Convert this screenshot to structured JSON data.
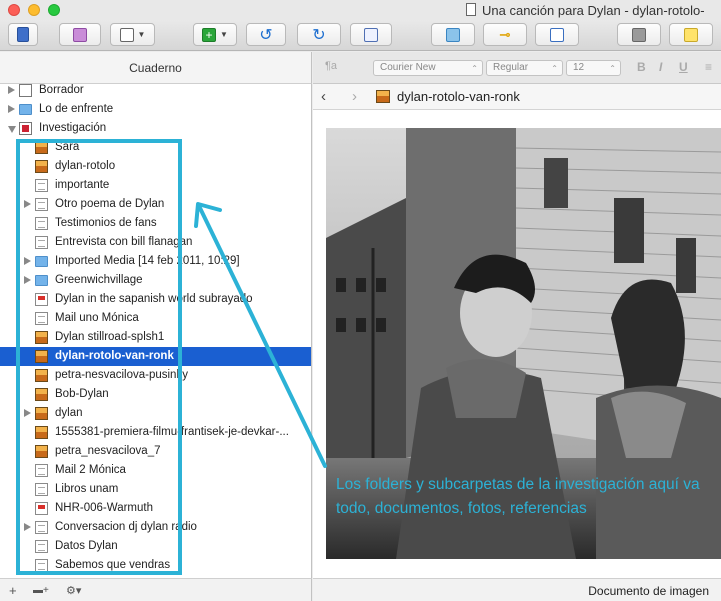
{
  "window": {
    "title": "Una canción para Dylan - dylan-rotolo-",
    "accent": "#1a5fd1",
    "annotation_color": "#2cb2d6"
  },
  "toolbar": {
    "buttons": [
      {
        "name": "binder-toggle-button",
        "icon": "binder-icon"
      },
      {
        "name": "inspector-button",
        "icon": "inspector-icon"
      },
      {
        "name": "view-mode-button",
        "icon": "view-mode-icon"
      },
      {
        "name": "add-button",
        "icon": "plus-icon"
      },
      {
        "name": "sync-button",
        "icon": "refresh-icon"
      },
      {
        "name": "compile-button",
        "icon": "compile-icon"
      },
      {
        "name": "outline-button",
        "icon": "outline-icon"
      },
      {
        "name": "fullscreen-button",
        "icon": "fullscreen-icon"
      },
      {
        "name": "keywords-button",
        "icon": "key-icon"
      },
      {
        "name": "edit-button",
        "icon": "pencil-icon"
      },
      {
        "name": "snapshot-button",
        "icon": "camera-icon"
      },
      {
        "name": "comment-button",
        "icon": "comment-icon"
      }
    ]
  },
  "binder": {
    "header": "Cuaderno",
    "items": [
      {
        "label": "Borrador",
        "icon": "draft-icon",
        "level": 0,
        "disclosure": "closed"
      },
      {
        "label": "Lo de enfrente",
        "icon": "folder-icon",
        "level": 0,
        "disclosure": "closed"
      },
      {
        "label": "Investigación",
        "icon": "research-icon",
        "level": 0,
        "disclosure": "open"
      },
      {
        "label": "Sara",
        "icon": "image-icon",
        "level": 1,
        "disclosure": "none"
      },
      {
        "label": "dylan-rotolo",
        "icon": "image-icon",
        "level": 1,
        "disclosure": "none"
      },
      {
        "label": "importante",
        "icon": "text-icon",
        "level": 1,
        "disclosure": "none"
      },
      {
        "label": "Otro poema de Dylan",
        "icon": "text-icon",
        "level": 1,
        "disclosure": "closed"
      },
      {
        "label": "Testimonios de fans",
        "icon": "text-icon",
        "level": 1,
        "disclosure": "none"
      },
      {
        "label": "Entrevista con bill flanagan",
        "icon": "text-icon",
        "level": 1,
        "disclosure": "none"
      },
      {
        "label": "Imported Media [14 feb 2011, 10:29]",
        "icon": "folder-icon",
        "level": 1,
        "disclosure": "closed"
      },
      {
        "label": "Greenwichvillage",
        "icon": "folder-icon",
        "level": 1,
        "disclosure": "closed"
      },
      {
        "label": "Dylan in the sapanish world subrayado",
        "icon": "pdf-icon",
        "level": 1,
        "disclosure": "none"
      },
      {
        "label": "Mail uno Mónica",
        "icon": "text-icon",
        "level": 1,
        "disclosure": "none"
      },
      {
        "label": "Dylan stillroad-splsh1",
        "icon": "image-icon",
        "level": 1,
        "disclosure": "none"
      },
      {
        "label": "dylan-rotolo-van-ronk",
        "icon": "image-icon",
        "level": 1,
        "disclosure": "none",
        "selected": true
      },
      {
        "label": "petra-nesvacilova-pusinky",
        "icon": "image-icon",
        "level": 1,
        "disclosure": "none"
      },
      {
        "label": "Bob-Dylan",
        "icon": "image-icon",
        "level": 1,
        "disclosure": "none"
      },
      {
        "label": "dylan",
        "icon": "image-icon",
        "level": 1,
        "disclosure": "closed"
      },
      {
        "label": "1555381-premiera-filmu-frantisek-je-devkar-...",
        "icon": "image-icon",
        "level": 1,
        "disclosure": "none"
      },
      {
        "label": "petra_nesvacilova_7",
        "icon": "image-icon",
        "level": 1,
        "disclosure": "none"
      },
      {
        "label": "Mail 2 Mónica",
        "icon": "text-icon",
        "level": 1,
        "disclosure": "none"
      },
      {
        "label": "Libros unam",
        "icon": "text-icon",
        "level": 1,
        "disclosure": "none"
      },
      {
        "label": "NHR-006-Warmuth",
        "icon": "pdf-icon",
        "level": 1,
        "disclosure": "none"
      },
      {
        "label": "Conversacion dj dylan radio",
        "icon": "text-icon",
        "level": 1,
        "disclosure": "closed"
      },
      {
        "label": "Datos Dylan",
        "icon": "text-icon",
        "level": 1,
        "disclosure": "none"
      },
      {
        "label": "Sabemos que  vendras",
        "icon": "text-icon",
        "level": 1,
        "disclosure": "none"
      }
    ]
  },
  "format_bar": {
    "style": "¶a",
    "font": "Courier New",
    "weight": "Regular",
    "size": "12",
    "bold": "B",
    "italic": "I",
    "underline": "U"
  },
  "editor": {
    "document_name": "dylan-rotolo-van-ronk",
    "back": "‹",
    "forward": "›"
  },
  "annotation": {
    "caption": "Los folders y subcarpetas de la investigación aquí va todo, documentos, fotos, referencias"
  },
  "status": {
    "label": "Documento de imagen"
  },
  "footer": {
    "add": "+",
    "add_folder": "▬+",
    "settings": "⚙▾"
  }
}
